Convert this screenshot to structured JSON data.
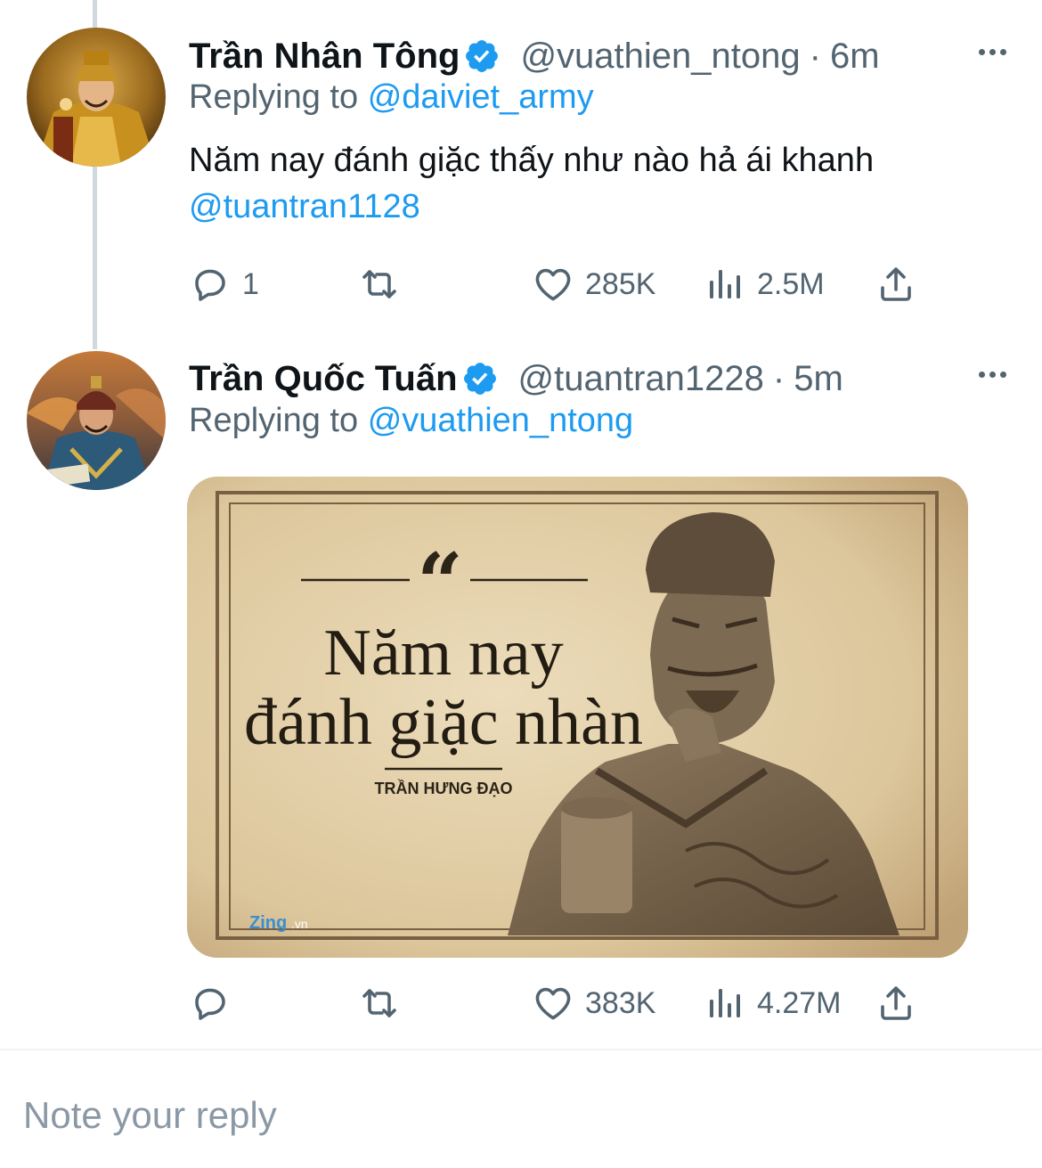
{
  "tweets": [
    {
      "name": "Trần Nhân Tông",
      "handle": "@vuathien_ntong",
      "separator": "·",
      "time": "6m",
      "replying_prefix": "Replying to",
      "replying_to": "@daiviet_army",
      "text": "Năm nay đánh giặc thấy như nào hả ái khanh",
      "mention": "@tuantran1128",
      "reply_count": "1",
      "retweet_count": "",
      "like_count": "285K",
      "view_count": "2.5M"
    },
    {
      "name": "Trần Quốc Tuấn",
      "handle": "@tuantran1228",
      "separator": "·",
      "time": "5m",
      "replying_prefix": "Replying to",
      "replying_to": "@vuathien_ntong",
      "reply_count": "",
      "retweet_count": "",
      "like_count": "383K",
      "view_count": "4.27M",
      "image": {
        "quote_mark": "“",
        "quote_line1": "Năm nay",
        "quote_line2": "đánh giặc nhàn",
        "author": "TRẦN HƯNG ĐẠO",
        "watermark": "Zing",
        "watermark_suffix": ".vn"
      }
    }
  ],
  "reply_box": {
    "placeholder": "Note your reply"
  },
  "colors": {
    "accent": "#1d9bf0",
    "secondary_text": "#536471",
    "thread_line": "#cfd9de"
  },
  "icons": [
    "verified-badge-icon",
    "more-icon",
    "reply-icon",
    "retweet-icon",
    "like-icon",
    "views-icon",
    "share-icon"
  ]
}
